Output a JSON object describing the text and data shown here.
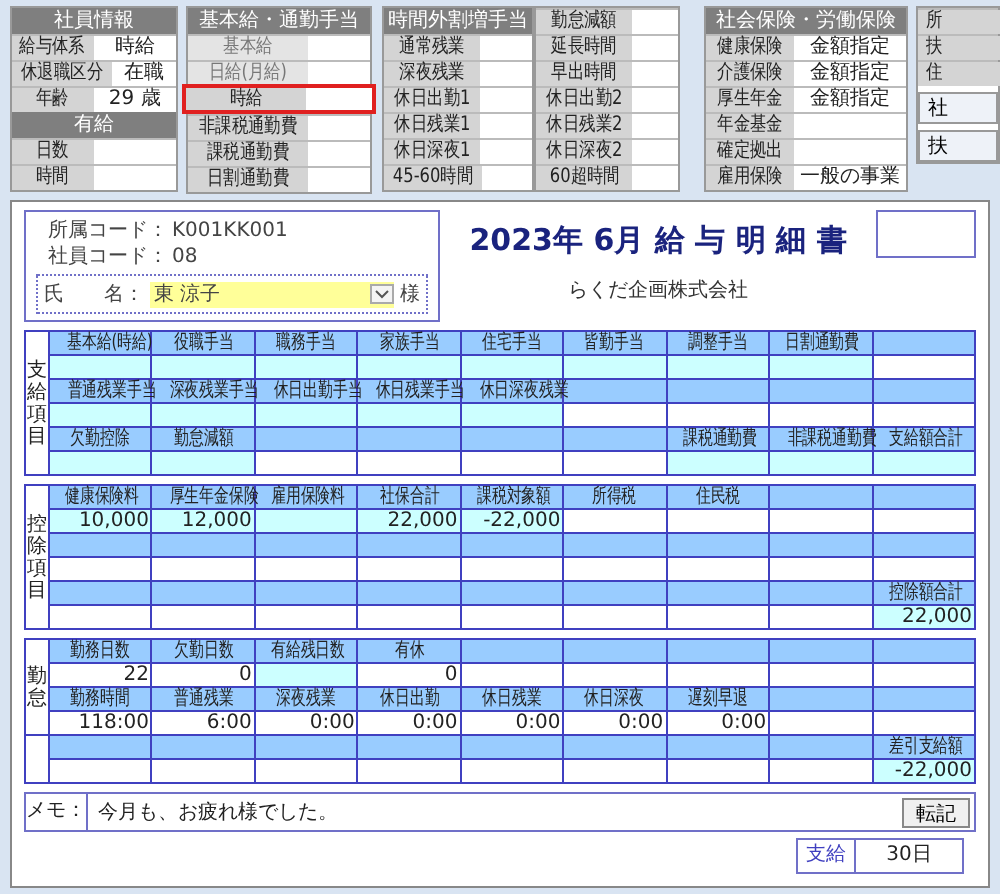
{
  "panels": [
    {
      "title": "社員情報",
      "rows": [
        {
          "kind": "field",
          "label": "給与体系",
          "value": "時給"
        },
        {
          "kind": "field",
          "label": "休退職区分",
          "value": "在職"
        },
        {
          "kind": "field",
          "label": "年齢",
          "value": "29 歳"
        },
        {
          "kind": "heading",
          "text": "有給"
        },
        {
          "kind": "field",
          "label": "日数"
        },
        {
          "kind": "field",
          "label": "時間"
        }
      ]
    },
    {
      "title": "基本給・通勤手当",
      "rows": [
        {
          "kind": "field",
          "label": "基本給",
          "disabled": true,
          "highlighted": false
        },
        {
          "kind": "field",
          "label": "日給(月給)",
          "disabled": true,
          "highlighted": false
        },
        {
          "kind": "field",
          "label": "時給",
          "disabled": false,
          "highlighted": true
        },
        {
          "kind": "field",
          "label": "非課税通勤費",
          "disabled": false,
          "highlighted": false
        },
        {
          "kind": "field",
          "label": "課税通勤費",
          "disabled": false,
          "highlighted": false
        },
        {
          "kind": "field",
          "label": "日割通勤費",
          "disabled": false,
          "highlighted": false
        }
      ]
    },
    {
      "title": "時間外割増手当",
      "rows": [
        {
          "kind": "field",
          "label": "通常残業"
        },
        {
          "kind": "field",
          "label": "深夜残業"
        },
        {
          "kind": "field",
          "label": "休日出勤1"
        },
        {
          "kind": "field",
          "label": "休日残業1"
        },
        {
          "kind": "field",
          "label": "休日深夜1"
        },
        {
          "kind": "field",
          "label": "45-60時間"
        }
      ]
    },
    {
      "rows": [
        {
          "kind": "field",
          "label": "勤怠減額"
        },
        {
          "kind": "field",
          "label": "延長時間"
        },
        {
          "kind": "field",
          "label": "早出時間"
        },
        {
          "kind": "field",
          "label": "休日出勤2"
        },
        {
          "kind": "field",
          "label": "休日残業2"
        },
        {
          "kind": "field",
          "label": "休日深夜2"
        },
        {
          "kind": "field",
          "label": "60超時間"
        }
      ]
    },
    {
      "title": "社会保険・労働保険",
      "rows": [
        {
          "kind": "field",
          "label": "健康保険",
          "value": "金額指定"
        },
        {
          "kind": "field",
          "label": "介護保険",
          "value": "金額指定"
        },
        {
          "kind": "field",
          "label": "厚生年金",
          "value": "金額指定"
        },
        {
          "kind": "field",
          "label": "年金基金"
        },
        {
          "kind": "field",
          "label": "確定拠出"
        },
        {
          "kind": "field",
          "label": "雇用保険",
          "value": "一般の事業"
        }
      ]
    },
    {
      "rows": [
        {
          "kind": "field",
          "label": "所"
        },
        {
          "kind": "field",
          "label": "扶"
        },
        {
          "kind": "field",
          "label": "住"
        },
        {
          "kind": "button",
          "label": "社"
        },
        {
          "kind": "button",
          "label": "扶"
        }
      ]
    }
  ],
  "slip": {
    "department_label": "所属コード：",
    "department_code": "K001KK001",
    "employee_label": "社員コード：",
    "employee_code": "08",
    "name_label": "氏　　名：",
    "name": "東 涼子",
    "honorific": "様",
    "title": "2023年 6月 給 与 明 細 書",
    "company": "らくだ企画株式会社"
  },
  "tables": [
    {
      "sections": [
        {
          "label": "支給項目",
          "rows": [
            {
              "kind": "header",
              "cells": [
                {
                  "text": "基本給(時給)"
                },
                {
                  "text": "役職手当"
                },
                {
                  "text": "職務手当"
                },
                {
                  "text": "家族手当"
                },
                {
                  "text": "住宅手当"
                },
                {
                  "text": "皆勤手当"
                },
                {
                  "text": "調整手当"
                },
                {
                  "text": "日割通勤費"
                },
                {}
              ]
            },
            {
              "kind": "value",
              "cells": [
                {
                  "shaded": true
                },
                {
                  "shaded": true
                },
                {
                  "shaded": true
                },
                {
                  "shaded": true
                },
                {
                  "shaded": true
                },
                {
                  "shaded": true
                },
                {
                  "shaded": true
                },
                {
                  "shaded": true
                },
                {
                  "shaded": false
                }
              ]
            },
            {
              "kind": "header",
              "cells": [
                {
                  "text": "普通残業手当"
                },
                {
                  "text": "深夜残業手当"
                },
                {
                  "text": "休日出勤手当"
                },
                {
                  "text": "休日残業手当"
                },
                {
                  "text": "休日深夜残業"
                },
                {},
                {},
                {},
                {}
              ]
            },
            {
              "kind": "value",
              "cells": [
                {
                  "shaded": true
                },
                {
                  "shaded": true
                },
                {
                  "shaded": true
                },
                {
                  "shaded": true
                },
                {
                  "shaded": true
                },
                {
                  "shaded": false
                },
                {
                  "shaded": false
                },
                {
                  "shaded": false
                },
                {
                  "shaded": false
                }
              ]
            },
            {
              "kind": "header",
              "cells": [
                {
                  "text": "欠勤控除"
                },
                {
                  "text": "勤怠減額"
                },
                {},
                {},
                {},
                {},
                {
                  "text": "課税通勤費"
                },
                {
                  "text": "非課税通勤費"
                },
                {
                  "text": "支給額合計"
                }
              ]
            },
            {
              "kind": "value",
              "cells": [
                {
                  "shaded": true
                },
                {
                  "shaded": true
                },
                {
                  "shaded": false
                },
                {
                  "shaded": false
                },
                {
                  "shaded": false
                },
                {
                  "shaded": false
                },
                {
                  "shaded": true
                },
                {
                  "shaded": true
                },
                {
                  "shaded": true
                }
              ]
            }
          ]
        }
      ]
    },
    {
      "sections": [
        {
          "label": "控除項目",
          "rows": [
            {
              "kind": "header",
              "cells": [
                {
                  "text": "健康保険料"
                },
                {
                  "text": "厚生年金保険"
                },
                {
                  "text": "雇用保険料"
                },
                {
                  "text": "社保合計"
                },
                {
                  "text": "課税対象額"
                },
                {
                  "text": "所得税"
                },
                {
                  "text": "住民税"
                },
                {},
                {}
              ]
            },
            {
              "kind": "value",
              "cells": [
                {
                  "text": "10,000",
                  "shaded": true
                },
                {
                  "text": "12,000",
                  "shaded": true
                },
                {
                  "shaded": true
                },
                {
                  "text": "22,000",
                  "shaded": true
                },
                {
                  "text": "-22,000",
                  "shaded": true
                },
                {
                  "shaded": false
                },
                {
                  "shaded": false
                },
                {
                  "shaded": false
                },
                {
                  "shaded": false
                }
              ]
            },
            {
              "kind": "header",
              "cells": [
                {},
                {},
                {},
                {},
                {},
                {},
                {},
                {},
                {}
              ]
            },
            {
              "kind": "value",
              "cells": [
                {
                  "shaded": false
                },
                {
                  "shaded": false
                },
                {
                  "shaded": false
                },
                {
                  "shaded": false
                },
                {
                  "shaded": false
                },
                {
                  "shaded": false
                },
                {
                  "shaded": false
                },
                {
                  "shaded": false
                },
                {
                  "shaded": false
                }
              ]
            },
            {
              "kind": "header",
              "cells": [
                {},
                {},
                {},
                {},
                {},
                {},
                {},
                {},
                {
                  "text": "控除額合計"
                }
              ]
            },
            {
              "kind": "value",
              "cells": [
                {
                  "shaded": false
                },
                {
                  "shaded": false
                },
                {
                  "shaded": false
                },
                {
                  "shaded": false
                },
                {
                  "shaded": false
                },
                {
                  "shaded": false
                },
                {
                  "shaded": false
                },
                {
                  "shaded": false
                },
                {
                  "text": "22,000",
                  "shaded": true
                }
              ]
            }
          ]
        }
      ]
    },
    {
      "sections": [
        {
          "label": "勤怠",
          "rows": [
            {
              "kind": "header",
              "cells": [
                {
                  "text": "勤務日数"
                },
                {
                  "text": "欠勤日数"
                },
                {
                  "text": "有給残日数"
                },
                {
                  "text": "有休"
                },
                {},
                {},
                {},
                {},
                {}
              ]
            },
            {
              "kind": "value",
              "cells": [
                {
                  "text": "22",
                  "shaded": false
                },
                {
                  "text": "0",
                  "shaded": false
                },
                {
                  "shaded": true
                },
                {
                  "text": "0",
                  "shaded": false
                },
                {
                  "shaded": false
                },
                {
                  "shaded": false
                },
                {
                  "shaded": false
                },
                {
                  "shaded": false
                },
                {
                  "shaded": false
                }
              ]
            },
            {
              "kind": "header",
              "cells": [
                {
                  "text": "勤務時間"
                },
                {
                  "text": "普通残業"
                },
                {
                  "text": "深夜残業"
                },
                {
                  "text": "休日出勤"
                },
                {
                  "text": "休日残業"
                },
                {
                  "text": "休日深夜"
                },
                {
                  "text": "遅刻早退"
                },
                {},
                {}
              ]
            },
            {
              "kind": "value",
              "cells": [
                {
                  "text": "118:00",
                  "shaded": false
                },
                {
                  "text": "6:00",
                  "shaded": false
                },
                {
                  "text": "0:00",
                  "shaded": false
                },
                {
                  "text": "0:00",
                  "shaded": false
                },
                {
                  "text": "0:00",
                  "shaded": false
                },
                {
                  "text": "0:00",
                  "shaded": false
                },
                {
                  "text": "0:00",
                  "shaded": false
                },
                {
                  "shaded": false
                },
                {
                  "shaded": false
                }
              ]
            }
          ]
        },
        {
          "rows": [
            {
              "kind": "header",
              "cells": [
                {},
                {},
                {},
                {},
                {},
                {},
                {},
                {},
                {
                  "text": "差引支給額"
                }
              ]
            },
            {
              "kind": "value",
              "cells": [
                {
                  "shaded": false
                },
                {
                  "shaded": false
                },
                {
                  "shaded": false
                },
                {
                  "shaded": false
                },
                {
                  "shaded": false
                },
                {
                  "shaded": false
                },
                {
                  "shaded": false
                },
                {
                  "shaded": false
                },
                {
                  "text": "-22,000",
                  "shaded": true
                }
              ]
            }
          ]
        }
      ]
    }
  ],
  "memo": {
    "label": "メモ：",
    "text": "今月も、お疲れ様でした。",
    "button": "転記"
  },
  "pay_date": {
    "label": "支給",
    "value": "30日"
  }
}
